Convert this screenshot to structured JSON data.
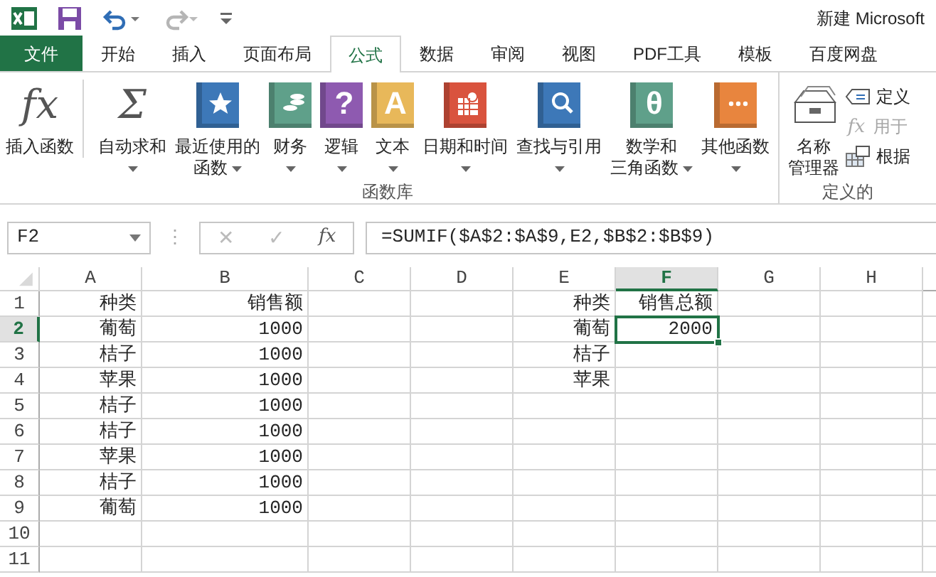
{
  "window": {
    "title": "新建 Microsoft"
  },
  "quick_access": [
    {
      "kind": "save",
      "disabled": false
    },
    {
      "kind": "undo",
      "disabled": false
    },
    {
      "kind": "redo",
      "disabled": true
    }
  ],
  "tabs": [
    {
      "label": "文件",
      "kind": "file",
      "selected": false
    },
    {
      "label": "开始",
      "kind": "tab",
      "selected": false
    },
    {
      "label": "插入",
      "kind": "tab",
      "selected": false
    },
    {
      "label": "页面布局",
      "kind": "tab",
      "selected": false
    },
    {
      "label": "公式",
      "kind": "tab",
      "selected": true
    },
    {
      "label": "数据",
      "kind": "tab",
      "selected": false
    },
    {
      "label": "审阅",
      "kind": "tab",
      "selected": false
    },
    {
      "label": "视图",
      "kind": "tab",
      "selected": false
    },
    {
      "label": "PDF工具",
      "kind": "tab",
      "selected": false
    },
    {
      "label": "模板",
      "kind": "tab",
      "selected": false
    },
    {
      "label": "百度网盘",
      "kind": "tab",
      "selected": false
    }
  ],
  "ribbon": {
    "groups": [
      {
        "label": "函数库",
        "buttons": [
          {
            "lines": [
              "插入函数"
            ],
            "dropdown": false,
            "icon": {
              "kind": "glyph",
              "glyph": "fx"
            }
          },
          {
            "lines": [
              "自动求和"
            ],
            "dropdown": true,
            "icon": {
              "kind": "glyph",
              "glyph": "Σ"
            }
          },
          {
            "lines": [
              "最近使用的",
              "函数"
            ],
            "dropdown": true,
            "icon": {
              "kind": "star",
              "color": "#3d78b8"
            }
          },
          {
            "lines": [
              "财务"
            ],
            "dropdown": true,
            "icon": {
              "kind": "coins",
              "color": "#5fa08a"
            }
          },
          {
            "lines": [
              "逻辑"
            ],
            "dropdown": true,
            "icon": {
              "kind": "glyph",
              "color": "#8e5ab0",
              "glyph": "?"
            }
          },
          {
            "lines": [
              "文本"
            ],
            "dropdown": true,
            "icon": {
              "kind": "glyph",
              "color": "#e8b85a",
              "glyph": "A"
            }
          },
          {
            "lines": [
              "日期和时间"
            ],
            "dropdown": true,
            "icon": {
              "kind": "calendar",
              "color": "#d9533e"
            }
          },
          {
            "lines": [
              "查找与引用"
            ],
            "dropdown": true,
            "icon": {
              "kind": "magnifier",
              "color": "#3d78b8"
            }
          },
          {
            "lines": [
              "数学和",
              "三角函数"
            ],
            "dropdown": true,
            "icon": {
              "kind": "glyph",
              "color": "#5fa08a",
              "glyph": "θ"
            }
          },
          {
            "lines": [
              "其他函数"
            ],
            "dropdown": true,
            "icon": {
              "kind": "dots",
              "color": "#e8853e"
            }
          }
        ]
      },
      {
        "label": "定义的",
        "buttons": [
          {
            "lines": [
              "名称",
              "管理器"
            ],
            "dropdown": false,
            "icon": {
              "kind": "drawer"
            }
          }
        ],
        "small_buttons": [
          {
            "label": "定义",
            "disabled": false,
            "icon": {
              "kind": "tag"
            }
          },
          {
            "label": "用于",
            "disabled": true,
            "icon": {
              "kind": "glyph",
              "glyph": "fx"
            }
          },
          {
            "label": "根据",
            "disabled": false,
            "icon": {
              "kind": "table"
            }
          }
        ]
      }
    ]
  },
  "formula_bar": {
    "name_box": "F2",
    "separator": "⋮",
    "cancel": "✕",
    "enter": "✓",
    "function_glyph": "fx",
    "formula": "=SUMIF($A$2:$A$9,E2,$B$2:$B$9)"
  },
  "sheet": {
    "columns": [
      {
        "label": "A",
        "selected": false
      },
      {
        "label": "B",
        "selected": false
      },
      {
        "label": "C",
        "selected": false
      },
      {
        "label": "D",
        "selected": false
      },
      {
        "label": "E",
        "selected": false
      },
      {
        "label": "F",
        "selected": true
      },
      {
        "label": "G",
        "selected": false
      },
      {
        "label": "H",
        "selected": false
      }
    ],
    "rows": [
      {
        "number": "1",
        "selected": false,
        "column_1": "种类",
        "column_2": "销售额",
        "column_5": "种类",
        "column_6": "销售总额"
      },
      {
        "number": "2",
        "selected": true,
        "column_1": "葡萄",
        "column_2": "1000",
        "column_5": "葡萄",
        "column_6": "2000"
      },
      {
        "number": "3",
        "selected": false,
        "column_1": "桔子",
        "column_2": "1000",
        "column_5": "桔子"
      },
      {
        "number": "4",
        "selected": false,
        "column_1": "苹果",
        "column_2": "1000",
        "column_5": "苹果"
      },
      {
        "number": "5",
        "selected": false,
        "column_1": "桔子",
        "column_2": "1000"
      },
      {
        "number": "6",
        "selected": false,
        "column_1": "桔子",
        "column_2": "1000"
      },
      {
        "number": "7",
        "selected": false,
        "column_1": "苹果",
        "column_2": "1000"
      },
      {
        "number": "8",
        "selected": false,
        "column_1": "桔子",
        "column_2": "1000"
      },
      {
        "number": "9",
        "selected": false,
        "column_1": "葡萄",
        "column_2": "1000"
      },
      {
        "number": "10",
        "selected": false
      },
      {
        "number": "11",
        "selected": false
      }
    ]
  }
}
